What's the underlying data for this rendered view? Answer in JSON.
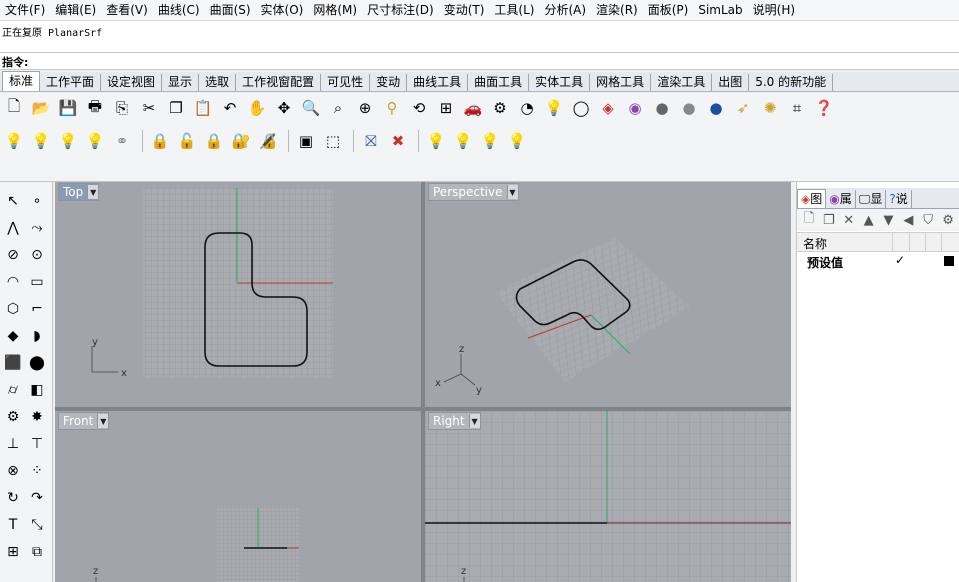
{
  "menu": [
    "文件(F)",
    "编辑(E)",
    "查看(V)",
    "曲线(C)",
    "曲面(S)",
    "实体(O)",
    "网格(M)",
    "尺寸标注(D)",
    "变动(T)",
    "工具(L)",
    "分析(A)",
    "渲染(R)",
    "面板(P)",
    "SimLab",
    "说明(H)"
  ],
  "command": {
    "history": "正在复原 PlanarSrf",
    "prompt": "指令:"
  },
  "tabs": [
    "标准",
    "工作平面",
    "设定视图",
    "显示",
    "选取",
    "工作视窗配置",
    "可见性",
    "变动",
    "曲线工具",
    "曲面工具",
    "实体工具",
    "网格工具",
    "渲染工具",
    "出图",
    "5.0 的新功能"
  ],
  "toolbar_icons_row1": [
    "new-file-icon",
    "open-folder-icon",
    "save-icon",
    "print-icon",
    "import-icon",
    "cut-icon",
    "copy-icon",
    "paste-icon",
    "undo-icon",
    "pan-hand-icon",
    "rotate-view-icon",
    "zoom-icon",
    "zoom-window-icon",
    "zoom-extents-icon",
    "zoom-selected-icon",
    "zoom-dynamic-icon",
    "four-viewports-icon",
    "car-icon",
    "gears-icon",
    "camera-icon",
    "light-bulb-icon",
    "circle-icon",
    "layer-stack-icon",
    "color-wheel-icon",
    "shaded-sphere-icon",
    "rendered-sphere-icon",
    "blue-sphere-icon",
    "pointer-icon",
    "settings-icon",
    "options-icon",
    "help-icon"
  ],
  "toolbar_icons_row2": [
    "bulb-on-icon",
    "bulb-off-icon",
    "bulb-yellow-icon",
    "bulb-selected-icon",
    "bulb-swap-icon",
    "lock-icon",
    "unlock-icon",
    "lock-selected-icon",
    "lock-swap-icon",
    "lock-group-icon",
    "block-icon",
    "block-dotted-icon",
    "hide-icon",
    "unhide-icon",
    "bulb-dim-1-icon",
    "bulb-dim-2-icon",
    "bulb-dim-3-icon",
    "bulb-dim-4-icon"
  ],
  "viewports": {
    "top": {
      "title": "Top",
      "axis_x": "x",
      "axis_y": "y"
    },
    "perspective": {
      "title": "Perspective",
      "axis_x": "x",
      "axis_y": "y",
      "axis_z": "z"
    },
    "front": {
      "title": "Front",
      "axis_z": "z"
    },
    "right": {
      "title": "Right",
      "axis_z": "z"
    }
  },
  "panel": {
    "tabs": [
      "图",
      "属",
      "显",
      "说"
    ],
    "column_name": "名称",
    "row": {
      "name": "预设值",
      "check": "✓"
    }
  },
  "colors": {
    "grid_bg": "#a1a4aa",
    "grid_line": "#8e9197",
    "x_axis": "#c0392b",
    "y_axis": "#27ae60",
    "curve": "#111111"
  }
}
